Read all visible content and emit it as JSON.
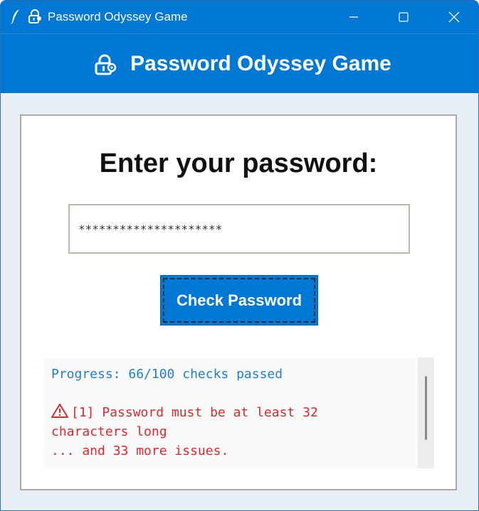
{
  "window": {
    "title": "Password Odyssey Game",
    "icon_left": "feather-icon",
    "icon_app": "lock-icon"
  },
  "header": {
    "icon": "lock-icon",
    "title": "Password Odyssey Game"
  },
  "main": {
    "prompt": "Enter your password:",
    "password_value": "*********************",
    "check_button_label": "Check Password"
  },
  "result": {
    "progress": "Progress: 66/100 checks passed",
    "warning_icon": "warning-icon",
    "issue_1_part1": "[1] Password must be at least 32",
    "issue_1_part2": "characters long",
    "more_issues": "... and 33 more issues."
  },
  "colors": {
    "brand_blue": "#0078d4",
    "progress_text": "#1e7fcf",
    "error_text": "#e3262b",
    "background": "#e8eef6"
  }
}
